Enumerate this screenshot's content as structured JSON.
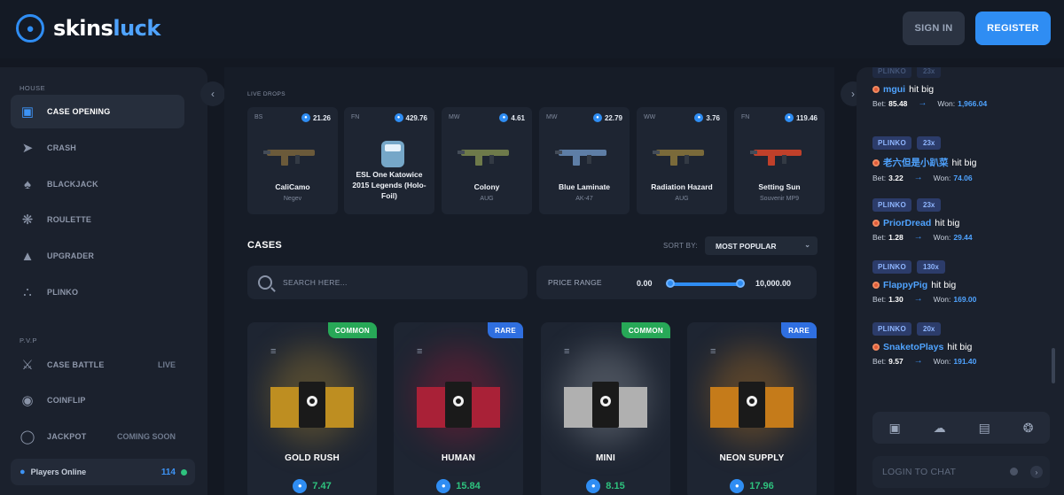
{
  "header": {
    "brand_part1": "skins",
    "brand_part2": "luck",
    "signin_label": "SIGN IN",
    "register_label": "REGISTER"
  },
  "sidebar": {
    "section_house": "HOUSE",
    "section_pvp": "P.V.P",
    "house_items": [
      {
        "label": "CASE OPENING",
        "icon": "case-icon"
      },
      {
        "label": "CRASH",
        "icon": "rocket-icon"
      },
      {
        "label": "BLACKJACK",
        "icon": "cards-icon"
      },
      {
        "label": "ROULETTE",
        "icon": "roulette-icon"
      },
      {
        "label": "UPGRADER",
        "icon": "upgrade-icon"
      },
      {
        "label": "PLINKO",
        "icon": "plinko-icon"
      }
    ],
    "pvp_items": [
      {
        "label": "CASE BATTLE",
        "tag": "LIVE",
        "icon": "swords-icon"
      },
      {
        "label": "COINFLIP",
        "icon": "coin-icon"
      },
      {
        "label": "JACKPOT",
        "tag": "COMING SOON",
        "icon": "jackpot-icon"
      }
    ],
    "players_label": "Players Online",
    "players_count": "114"
  },
  "live_drops": {
    "label": "LIVE DROPS",
    "items": [
      {
        "condition": "BS",
        "price": "21.26",
        "name": "CaliCamo",
        "sub": "Negev",
        "color": "#6b5a3a"
      },
      {
        "condition": "FN",
        "price": "429.76",
        "name": "ESL One Katowice 2015 Legends (Holo-Foil)",
        "sub": "",
        "color": "#7fb6d8"
      },
      {
        "condition": "MW",
        "price": "4.61",
        "name": "Colony",
        "sub": "AUG",
        "color": "#6e7a4a"
      },
      {
        "condition": "MW",
        "price": "22.79",
        "name": "Blue Laminate",
        "sub": "AK-47",
        "color": "#5e7ea6"
      },
      {
        "condition": "WW",
        "price": "3.76",
        "name": "Radiation Hazard",
        "sub": "AUG",
        "color": "#7a6a3a"
      },
      {
        "condition": "FN",
        "price": "119.46",
        "name": "Setting Sun",
        "sub": "Souvenir MP9",
        "color": "#c0402a"
      }
    ]
  },
  "cases_section": {
    "title": "CASES",
    "sort_label": "SORT BY:",
    "sort_value": "MOST POPULAR",
    "search_placeholder": "SEARCH HERE...",
    "price_range_label": "PRICE RANGE",
    "price_min": "0.00",
    "price_max": "10,000.00"
  },
  "cases": [
    {
      "name": "GOLD RUSH",
      "price": "7.47",
      "badge": "COMMON",
      "badge_color": "#27a857",
      "accent": "#d8a020",
      "glow": "#b08a30"
    },
    {
      "name": "HUMAN",
      "price": "15.84",
      "badge": "RARE",
      "badge_color": "#2f6fe0",
      "accent": "#c0203a",
      "glow": "#a01838"
    },
    {
      "name": "MINI",
      "price": "8.15",
      "badge": "COMMON",
      "badge_color": "#27a857",
      "accent": "#c8c8c8",
      "glow": "#9aa0a8"
    },
    {
      "name": "NEON SUPPLY",
      "price": "17.96",
      "badge": "RARE",
      "badge_color": "#2f6fe0",
      "accent": "#e08a18",
      "glow": "#c07a20"
    }
  ],
  "feed": [
    {
      "game": "PLINKO",
      "mult": "23x",
      "user": "mgui",
      "hit": "hit big",
      "bet_label": "Bet:",
      "bet": "85.48",
      "won_label": "Won:",
      "won": "1,966.04"
    },
    {
      "game": "PLINKO",
      "mult": "23x",
      "user": "老六但是小趴菜",
      "hit": "hit big",
      "bet_label": "Bet:",
      "bet": "3.22",
      "won_label": "Won:",
      "won": "74.06"
    },
    {
      "game": "PLINKO",
      "mult": "23x",
      "user": "PriorDread",
      "hit": "hit big",
      "bet_label": "Bet:",
      "bet": "1.28",
      "won_label": "Won:",
      "won": "29.44"
    },
    {
      "game": "PLINKO",
      "mult": "130x",
      "user": "FlappyPig",
      "hit": "hit big",
      "bet_label": "Bet:",
      "bet": "1.30",
      "won_label": "Won:",
      "won": "169.00"
    },
    {
      "game": "PLINKO",
      "mult": "20x",
      "user": "SnaketoPlays",
      "hit": "hit big",
      "bet_label": "Bet:",
      "bet": "9.57",
      "won_label": "Won:",
      "won": "191.40"
    }
  ],
  "chat": {
    "input_placeholder": "LOGIN TO CHAT",
    "tools": [
      "gift-icon",
      "rain-icon",
      "clipboard-icon",
      "support-icon"
    ]
  }
}
